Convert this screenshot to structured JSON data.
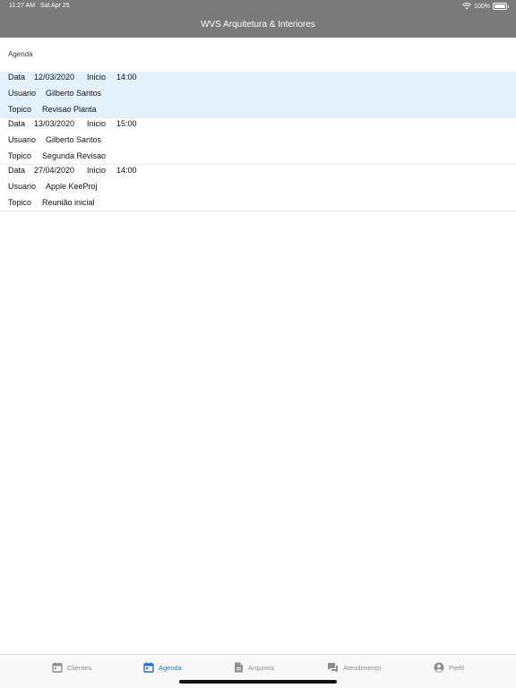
{
  "status_bar": {
    "time": "11:27 AM",
    "date": "Sat Apr 25",
    "battery": "100%",
    "battery_level": 1.0
  },
  "header": {
    "title": "WVS Arquitetura & Interiores"
  },
  "section": {
    "title": "Agenda"
  },
  "labels": {
    "data": "Data",
    "inicio": "Inicio",
    "usuario": "Usuario",
    "topico": "Topico"
  },
  "agenda": [
    {
      "data": "12/03/2020",
      "inicio": "14:00",
      "usuario": "Gilberto Santos",
      "topico": "Revisao Planta",
      "selected": true
    },
    {
      "data": "13/03/2020",
      "inicio": "15:00",
      "usuario": "Gilberto Santos",
      "topico": "Segunda Revisao",
      "selected": false
    },
    {
      "data": "27/04/2020",
      "inicio": "14:00",
      "usuario": "Apple KeeProj",
      "topico": "Reunião inicial",
      "selected": false
    }
  ],
  "tabs": [
    {
      "label": "Clientes",
      "icon": "calendar-blank-icon",
      "active": false
    },
    {
      "label": "Agenda",
      "icon": "calendar-icon",
      "active": true
    },
    {
      "label": "Arquivos",
      "icon": "document-icon",
      "active": false
    },
    {
      "label": "Atendimento",
      "icon": "chat-icon",
      "active": false
    },
    {
      "label": "Perfil",
      "icon": "account-circle-icon",
      "active": false
    }
  ],
  "colors": {
    "header_bg": "#7a7a7a",
    "selected_row_bg": "#e3f1fc",
    "active_tab": "#1a73e8",
    "inactive_tab": "#8e8e8e"
  }
}
